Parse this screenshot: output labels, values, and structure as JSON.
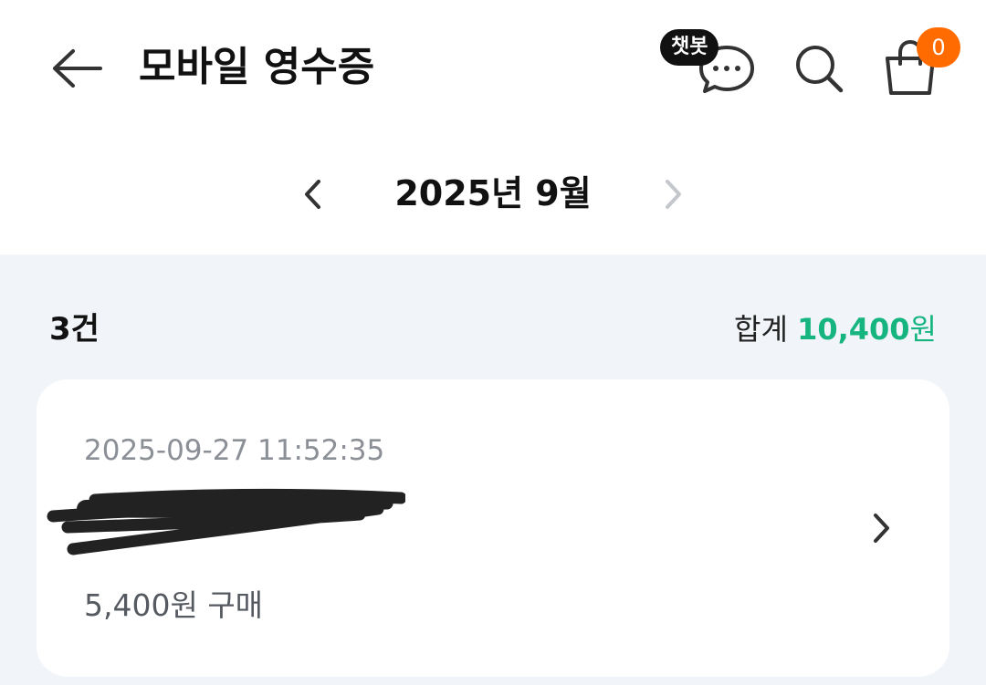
{
  "header": {
    "title": "모바일 영수증",
    "back_icon": "arrow-left-icon",
    "chatbot": {
      "label": "챗봇",
      "icon": "chat-bubble-icon"
    },
    "search_icon": "search-icon",
    "cart": {
      "icon": "shopping-bag-icon",
      "count": "0"
    }
  },
  "month_selector": {
    "label": "2025년 9월",
    "prev_icon": "chevron-left-icon",
    "next_icon": "chevron-right-icon",
    "next_disabled": true
  },
  "summary": {
    "count": "3건",
    "total_label": "합계",
    "total_amount": "10,400",
    "total_unit": "원"
  },
  "receipts": [
    {
      "datetime": "2025-09-27 11:52:35",
      "amount_text": "5,400원 구매",
      "store_name_redacted": true
    }
  ],
  "colors": {
    "accent": "#16b57f",
    "badge": "#ff6b00",
    "background": "#f1f4f9"
  }
}
